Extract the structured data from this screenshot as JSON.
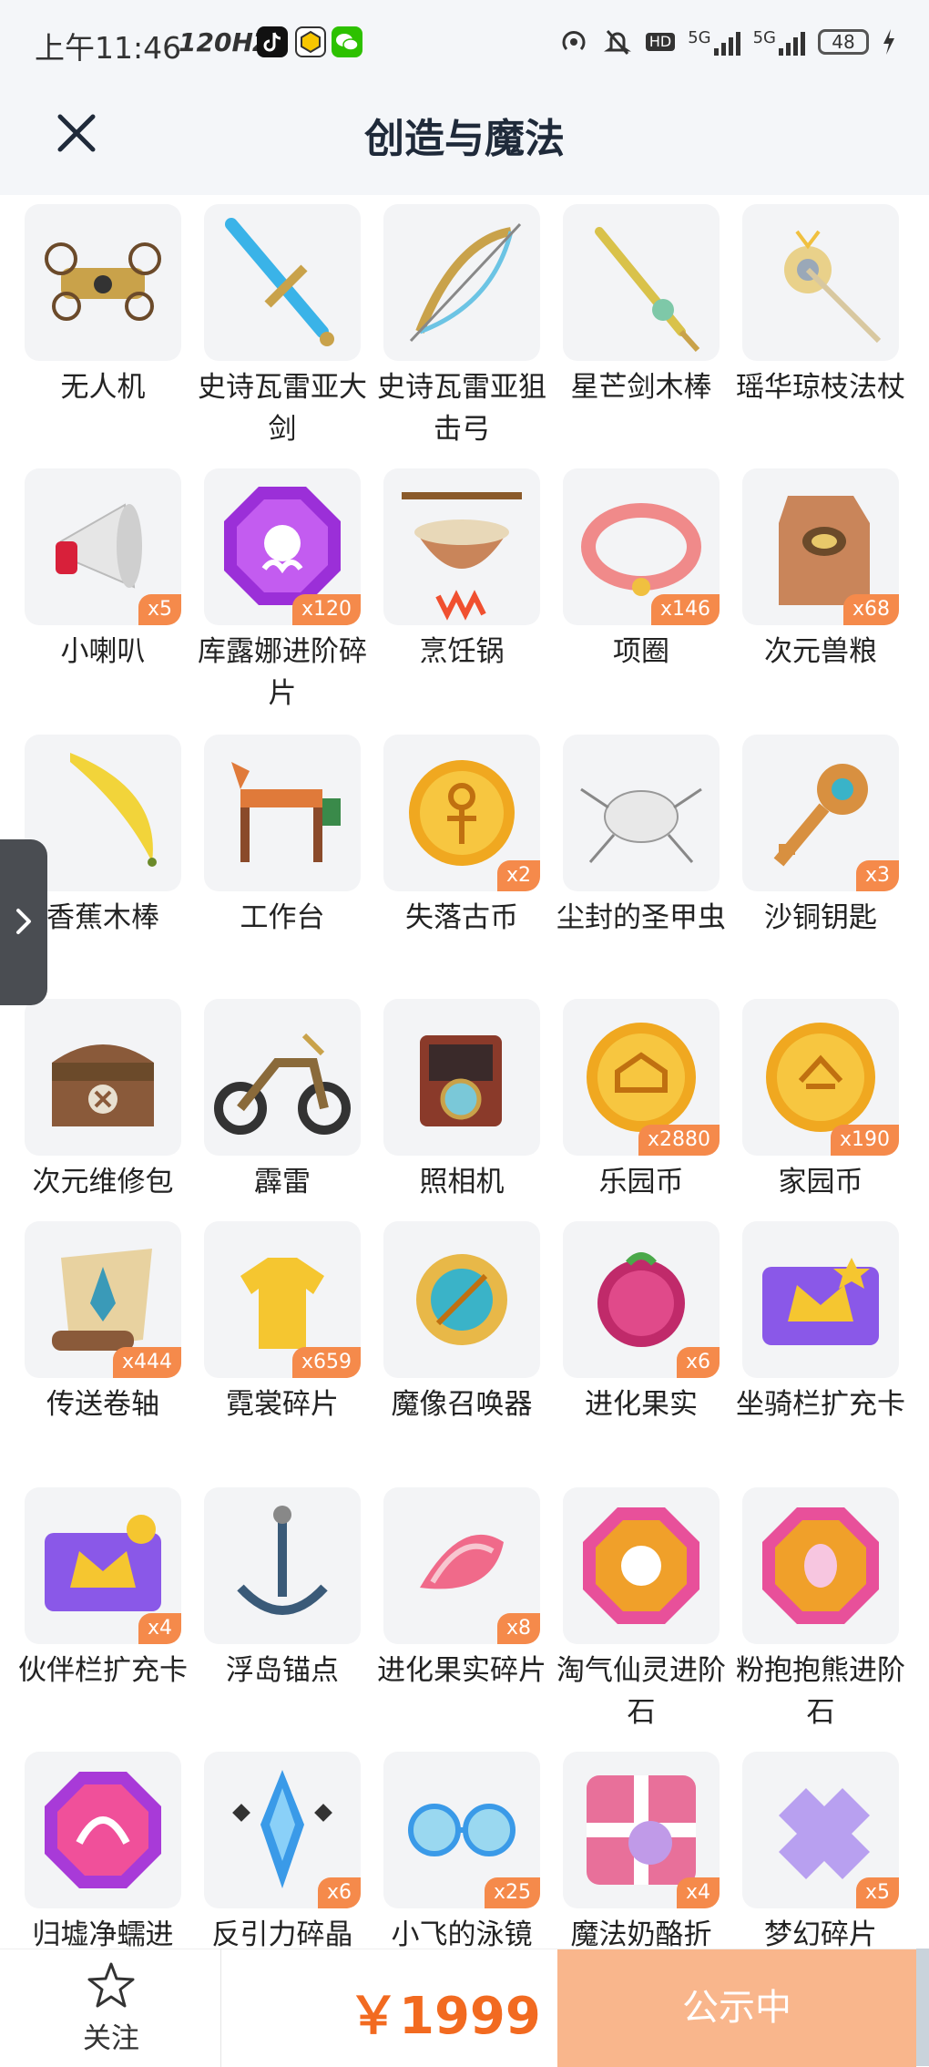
{
  "status_bar": {
    "time": "上午11:46",
    "refresh_rate": "120HZ",
    "network_1": "5G",
    "network_2": "5G",
    "battery": "48"
  },
  "header": {
    "title": "创造与魔法",
    "close_icon": "close-icon"
  },
  "items": [
    {
      "name": "无人机",
      "count": ""
    },
    {
      "name": "史诗瓦雷亚大剑",
      "count": ""
    },
    {
      "name": "史诗瓦雷亚狙击弓",
      "count": ""
    },
    {
      "name": "星芒剑木棒",
      "count": ""
    },
    {
      "name": "瑶华琼枝法杖",
      "count": ""
    },
    {
      "name": "小喇叭",
      "count": "x5"
    },
    {
      "name": "库露娜进阶碎片",
      "count": "x120"
    },
    {
      "name": "烹饪锅",
      "count": ""
    },
    {
      "name": "项圈",
      "count": "x146"
    },
    {
      "name": "次元兽粮",
      "count": "x68"
    },
    {
      "name": "香蕉木棒",
      "count": ""
    },
    {
      "name": "工作台",
      "count": ""
    },
    {
      "name": "失落古币",
      "count": "x2"
    },
    {
      "name": "尘封的圣甲虫",
      "count": ""
    },
    {
      "name": "沙铜钥匙",
      "count": "x3"
    },
    {
      "name": "次元维修包",
      "count": ""
    },
    {
      "name": "霹雷",
      "count": ""
    },
    {
      "name": "照相机",
      "count": ""
    },
    {
      "name": "乐园币",
      "count": "x2880"
    },
    {
      "name": "家园币",
      "count": "x190"
    },
    {
      "name": "传送卷轴",
      "count": "x444"
    },
    {
      "name": "霓裳碎片",
      "count": "x659"
    },
    {
      "name": "魔像召唤器",
      "count": ""
    },
    {
      "name": "进化果实",
      "count": "x6"
    },
    {
      "name": "坐骑栏扩充卡",
      "count": ""
    },
    {
      "name": "伙伴栏扩充卡",
      "count": "x4"
    },
    {
      "name": "浮岛锚点",
      "count": ""
    },
    {
      "name": "进化果实碎片",
      "count": "x8"
    },
    {
      "name": "淘气仙灵进阶石",
      "count": ""
    },
    {
      "name": "粉抱抱熊进阶石",
      "count": ""
    },
    {
      "name": "归墟净蠕进",
      "count": ""
    },
    {
      "name": "反引力碎晶",
      "count": "x6"
    },
    {
      "name": "小飞的泳镜",
      "count": "x25"
    },
    {
      "name": "魔法奶酪折",
      "count": "x4"
    },
    {
      "name": "梦幻碎片",
      "count": "x5"
    }
  ],
  "bottom_bar": {
    "follow_label": "关注",
    "price": "￥1999",
    "status_button": "公示中"
  },
  "colors": {
    "accent": "#f26a20",
    "badge": "#f58a4b",
    "status_button": "#f9b68c",
    "title": "#1f2a3a"
  }
}
